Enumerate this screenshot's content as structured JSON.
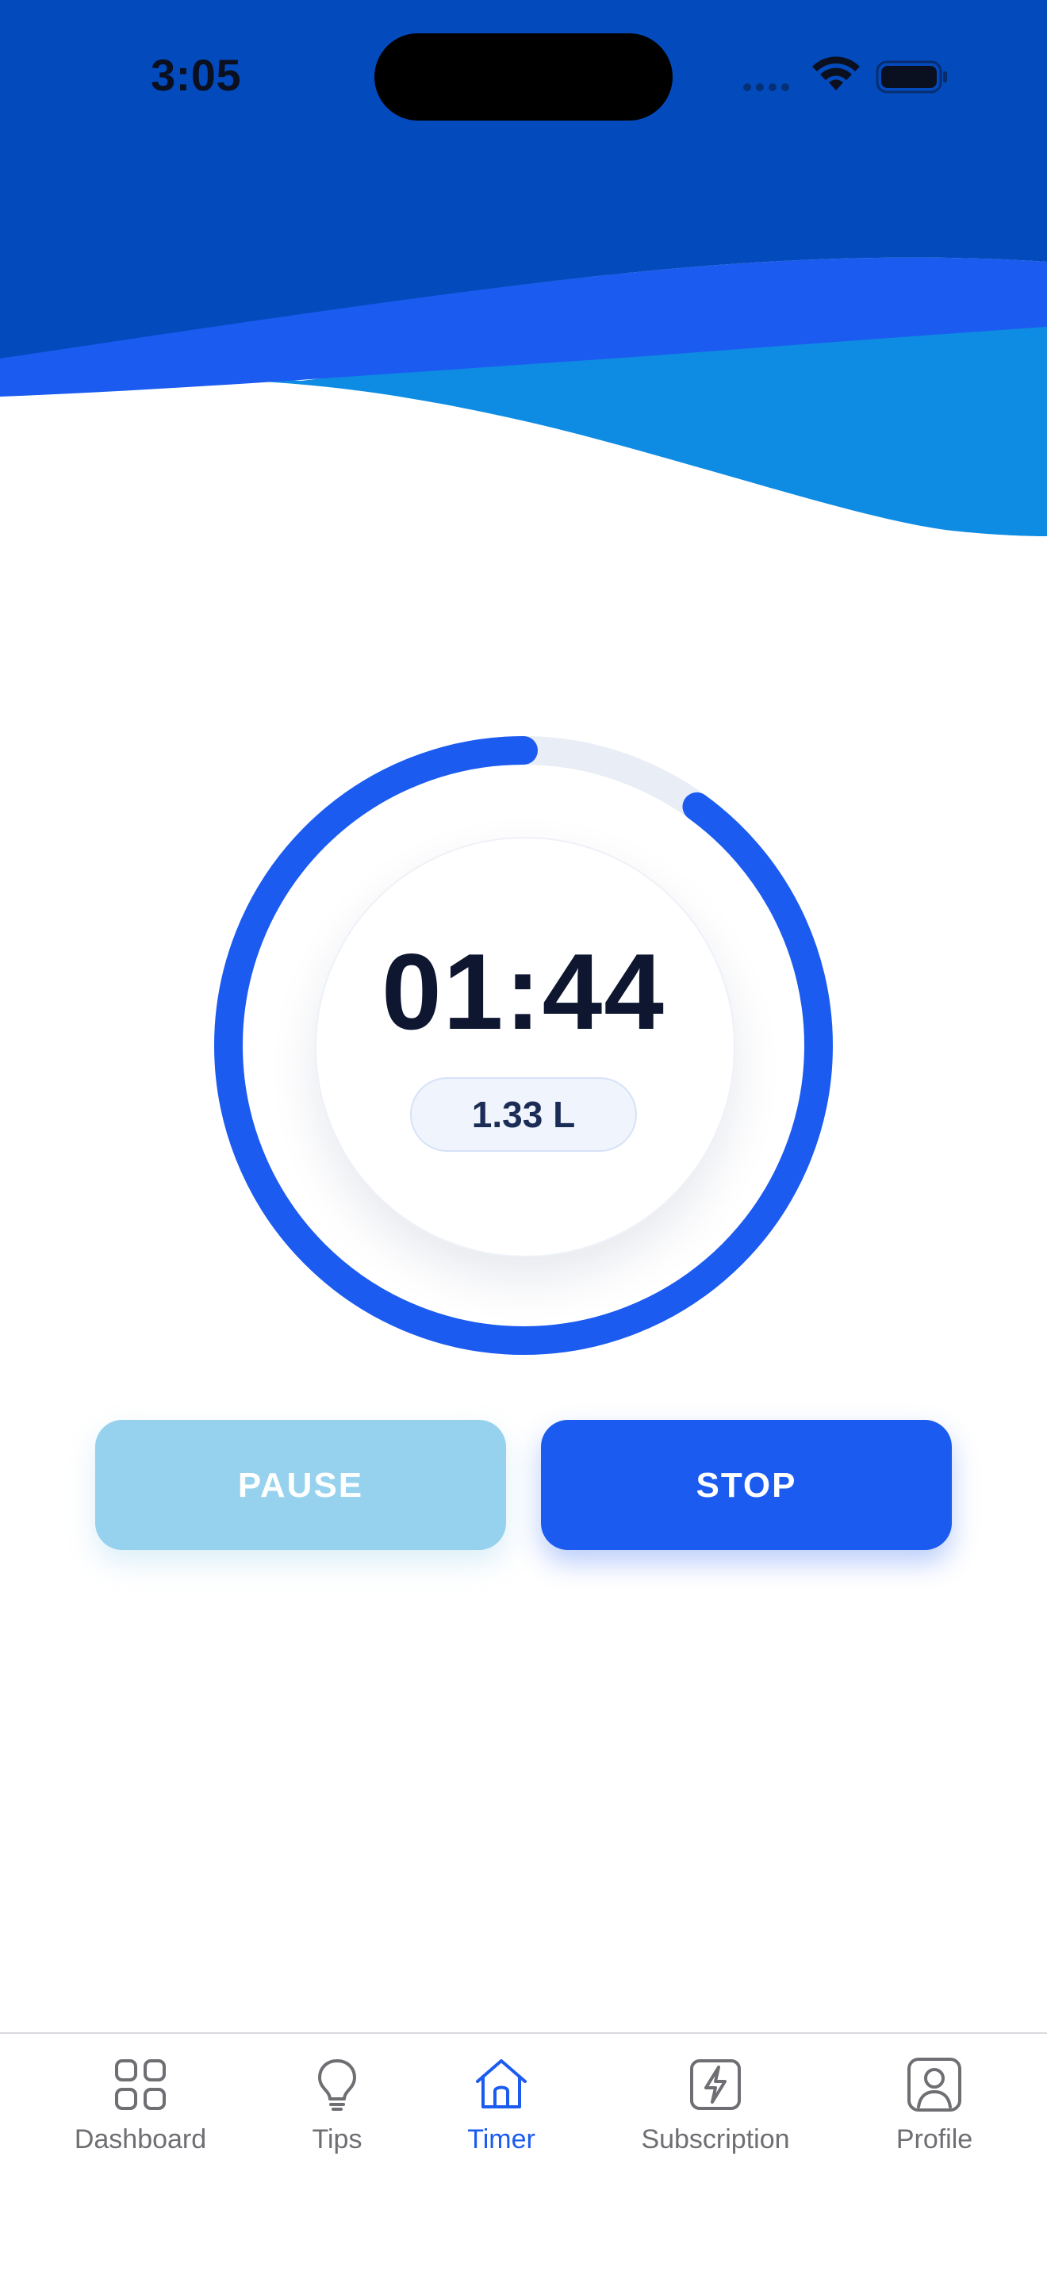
{
  "status_bar": {
    "time": "3:05",
    "icons": [
      "cellular-dots-icon",
      "wifi-icon",
      "battery-icon"
    ]
  },
  "colors": {
    "header_dark": "#034bbd",
    "header_mid": "#1b5bf0",
    "header_light": "#0e8ce3",
    "accent": "#1b5bf0",
    "track": "#e8edf6",
    "pause_button": "#96d2ed",
    "stop_button": "#1b5bf0",
    "tab_inactive": "#6e6e73",
    "tab_active": "#1b5bf0"
  },
  "timer": {
    "display": "01:44",
    "volume": "1.33 L",
    "progress_fraction": 0.9
  },
  "controls": {
    "pause_label": "PAUSE",
    "stop_label": "STOP"
  },
  "tab_bar": {
    "items": [
      {
        "label": "Dashboard",
        "icon": "grid-icon",
        "active": false
      },
      {
        "label": "Tips",
        "icon": "lightbulb-icon",
        "active": false
      },
      {
        "label": "Timer",
        "icon": "home-icon",
        "active": true
      },
      {
        "label": "Subscription",
        "icon": "lightning-icon",
        "active": false
      },
      {
        "label": "Profile",
        "icon": "profile-icon",
        "active": false
      }
    ]
  }
}
